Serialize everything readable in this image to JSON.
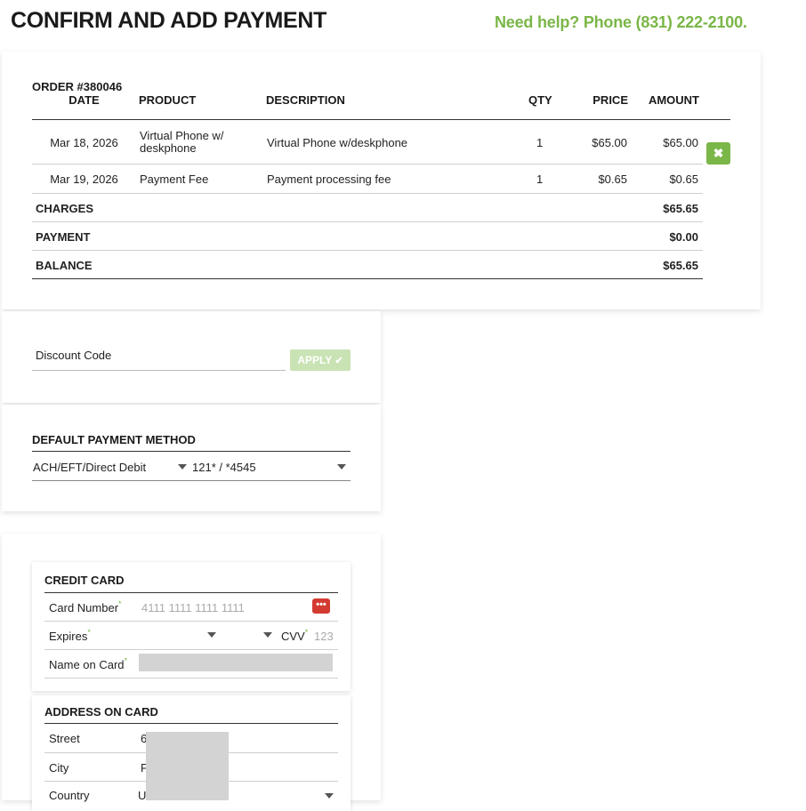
{
  "header": {
    "title": "CONFIRM AND ADD PAYMENT",
    "help": "Need help? Phone (831) 222-2100."
  },
  "order": {
    "columns": {
      "order_label": "ORDER #380046",
      "date": "DATE",
      "product": "PRODUCT",
      "description": "DESCRIPTION",
      "qty": "QTY",
      "price": "PRICE",
      "amount": "AMOUNT"
    },
    "rows": [
      {
        "date": "Mar 18, 2026",
        "product": "Virtual Phone w/ deskphone",
        "description": "Virtual Phone w/deskphone",
        "qty": "1",
        "price": "$65.00",
        "amount": "$65.00"
      },
      {
        "date": "Mar 19, 2026",
        "product": "Payment Fee",
        "description": "Payment processing fee",
        "qty": "1",
        "price": "$0.65",
        "amount": "$0.65"
      }
    ],
    "remove_icon": "close-icon",
    "totals": [
      {
        "label": "CHARGES",
        "value": "$65.65"
      },
      {
        "label": "PAYMENT",
        "value": "$0.00"
      },
      {
        "label": "BALANCE",
        "value": "$65.65"
      }
    ]
  },
  "discount": {
    "placeholder": "Discount Code",
    "apply_label": "APPLY",
    "apply_icon": "check-icon"
  },
  "payment_method": {
    "heading": "DEFAULT PAYMENT METHOD",
    "method": "ACH/EFT/Direct Debit",
    "account": "121* / *4545"
  },
  "credit_card": {
    "heading": "CREDIT CARD",
    "card_number_label": "Card Number",
    "card_number_placeholder": "4111 1111 1111 1111",
    "expires_label": "Expires",
    "cvv_label": "CVV",
    "cvv_placeholder": "123",
    "name_label": "Name on Card",
    "required_mark": "*",
    "password_icon_text": "•••"
  },
  "address": {
    "heading": "ADDRESS ON CARD",
    "street_label": "Street",
    "street_value_partial": "6",
    "city_label": "City",
    "city_value_partial": "F",
    "country_label": "Country",
    "country_value_partial": "U"
  },
  "colors": {
    "accent_green": "#7ab648",
    "apply_disabled": "#c9e3b4",
    "password_red": "#d33b32"
  }
}
